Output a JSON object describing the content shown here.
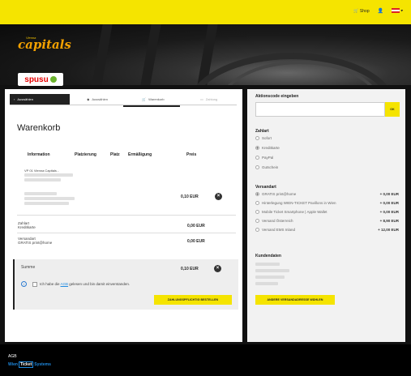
{
  "topbar": {
    "shop_label": "Shop",
    "shop_icon": "cart-icon",
    "user_icon": "user-icon",
    "flag": "austria-flag"
  },
  "hero": {
    "logo_top": "Vienna",
    "logo_main": "capitals",
    "sponsor": "spusu"
  },
  "steps": [
    {
      "label": "Auswählen",
      "state": "active"
    },
    {
      "label": "Auswählen",
      "state": "done"
    },
    {
      "label": "Warenkorb",
      "state": "done"
    },
    {
      "label": "Zahlung",
      "state": "disabled"
    }
  ],
  "cart": {
    "title": "Warenkorb",
    "headers": [
      "Information",
      "Platzierung",
      "Platz",
      "Ermäßigung",
      "Preis"
    ],
    "ticket_title": "VP 01 Vienna Capitals -",
    "ticket_price": "0,10 EUR",
    "payment_label": "Zahlart",
    "payment_value": "Kreditkarte",
    "payment_price": "0,00 EUR",
    "shipping_label": "Versandart",
    "shipping_value": "GRATIS print@home",
    "shipping_price": "0,00 EUR",
    "sum_label": "Summe",
    "sum_price": "0,10 EUR",
    "terms_prefix": "Ich habe die ",
    "terms_link": "AGB",
    "terms_suffix": " gelesen und bin damit einverstanden.",
    "order_button": "ZAHLUNGSPFLICHTIG BESTELLEN"
  },
  "sidebar": {
    "promo_title": "Aktionscode eingeben",
    "promo_button": "OK",
    "payment_title": "Zahlart",
    "payment_options": [
      {
        "label": "Sofort",
        "selected": false
      },
      {
        "label": "Kreditkarte",
        "selected": true
      },
      {
        "label": "PayPal",
        "selected": false
      },
      {
        "label": "Gutschein",
        "selected": false
      }
    ],
    "shipping_title": "Versandart",
    "shipping_options": [
      {
        "label": "GRATIS print@home",
        "price": "+ 0,00 EUR",
        "selected": true
      },
      {
        "label": "Hinterlegung WIEN-TICKET Pavillons in Wien",
        "price": "+ 0,00 EUR",
        "selected": false
      },
      {
        "label": "Mobile Ticket Smartphone | Apple Wallet",
        "price": "+ 0,00 EUR",
        "selected": false
      },
      {
        "label": "Versand Österreich",
        "price": "+ 8,90 EUR",
        "selected": false
      },
      {
        "label": "Versand EMS Inland",
        "price": "+ 12,00 EUR",
        "selected": false
      }
    ],
    "customer_title": "Kundendaten",
    "address_button": "ANDERE VERSANDADRESSE WÄHLEN"
  },
  "footer": {
    "agb": "AGB",
    "brand_a": "Wien",
    "brand_b": "Ticket",
    "brand_c": "Systems"
  },
  "colors": {
    "accent": "#f5e400",
    "dark": "#222222",
    "link": "#1f8ae0"
  }
}
